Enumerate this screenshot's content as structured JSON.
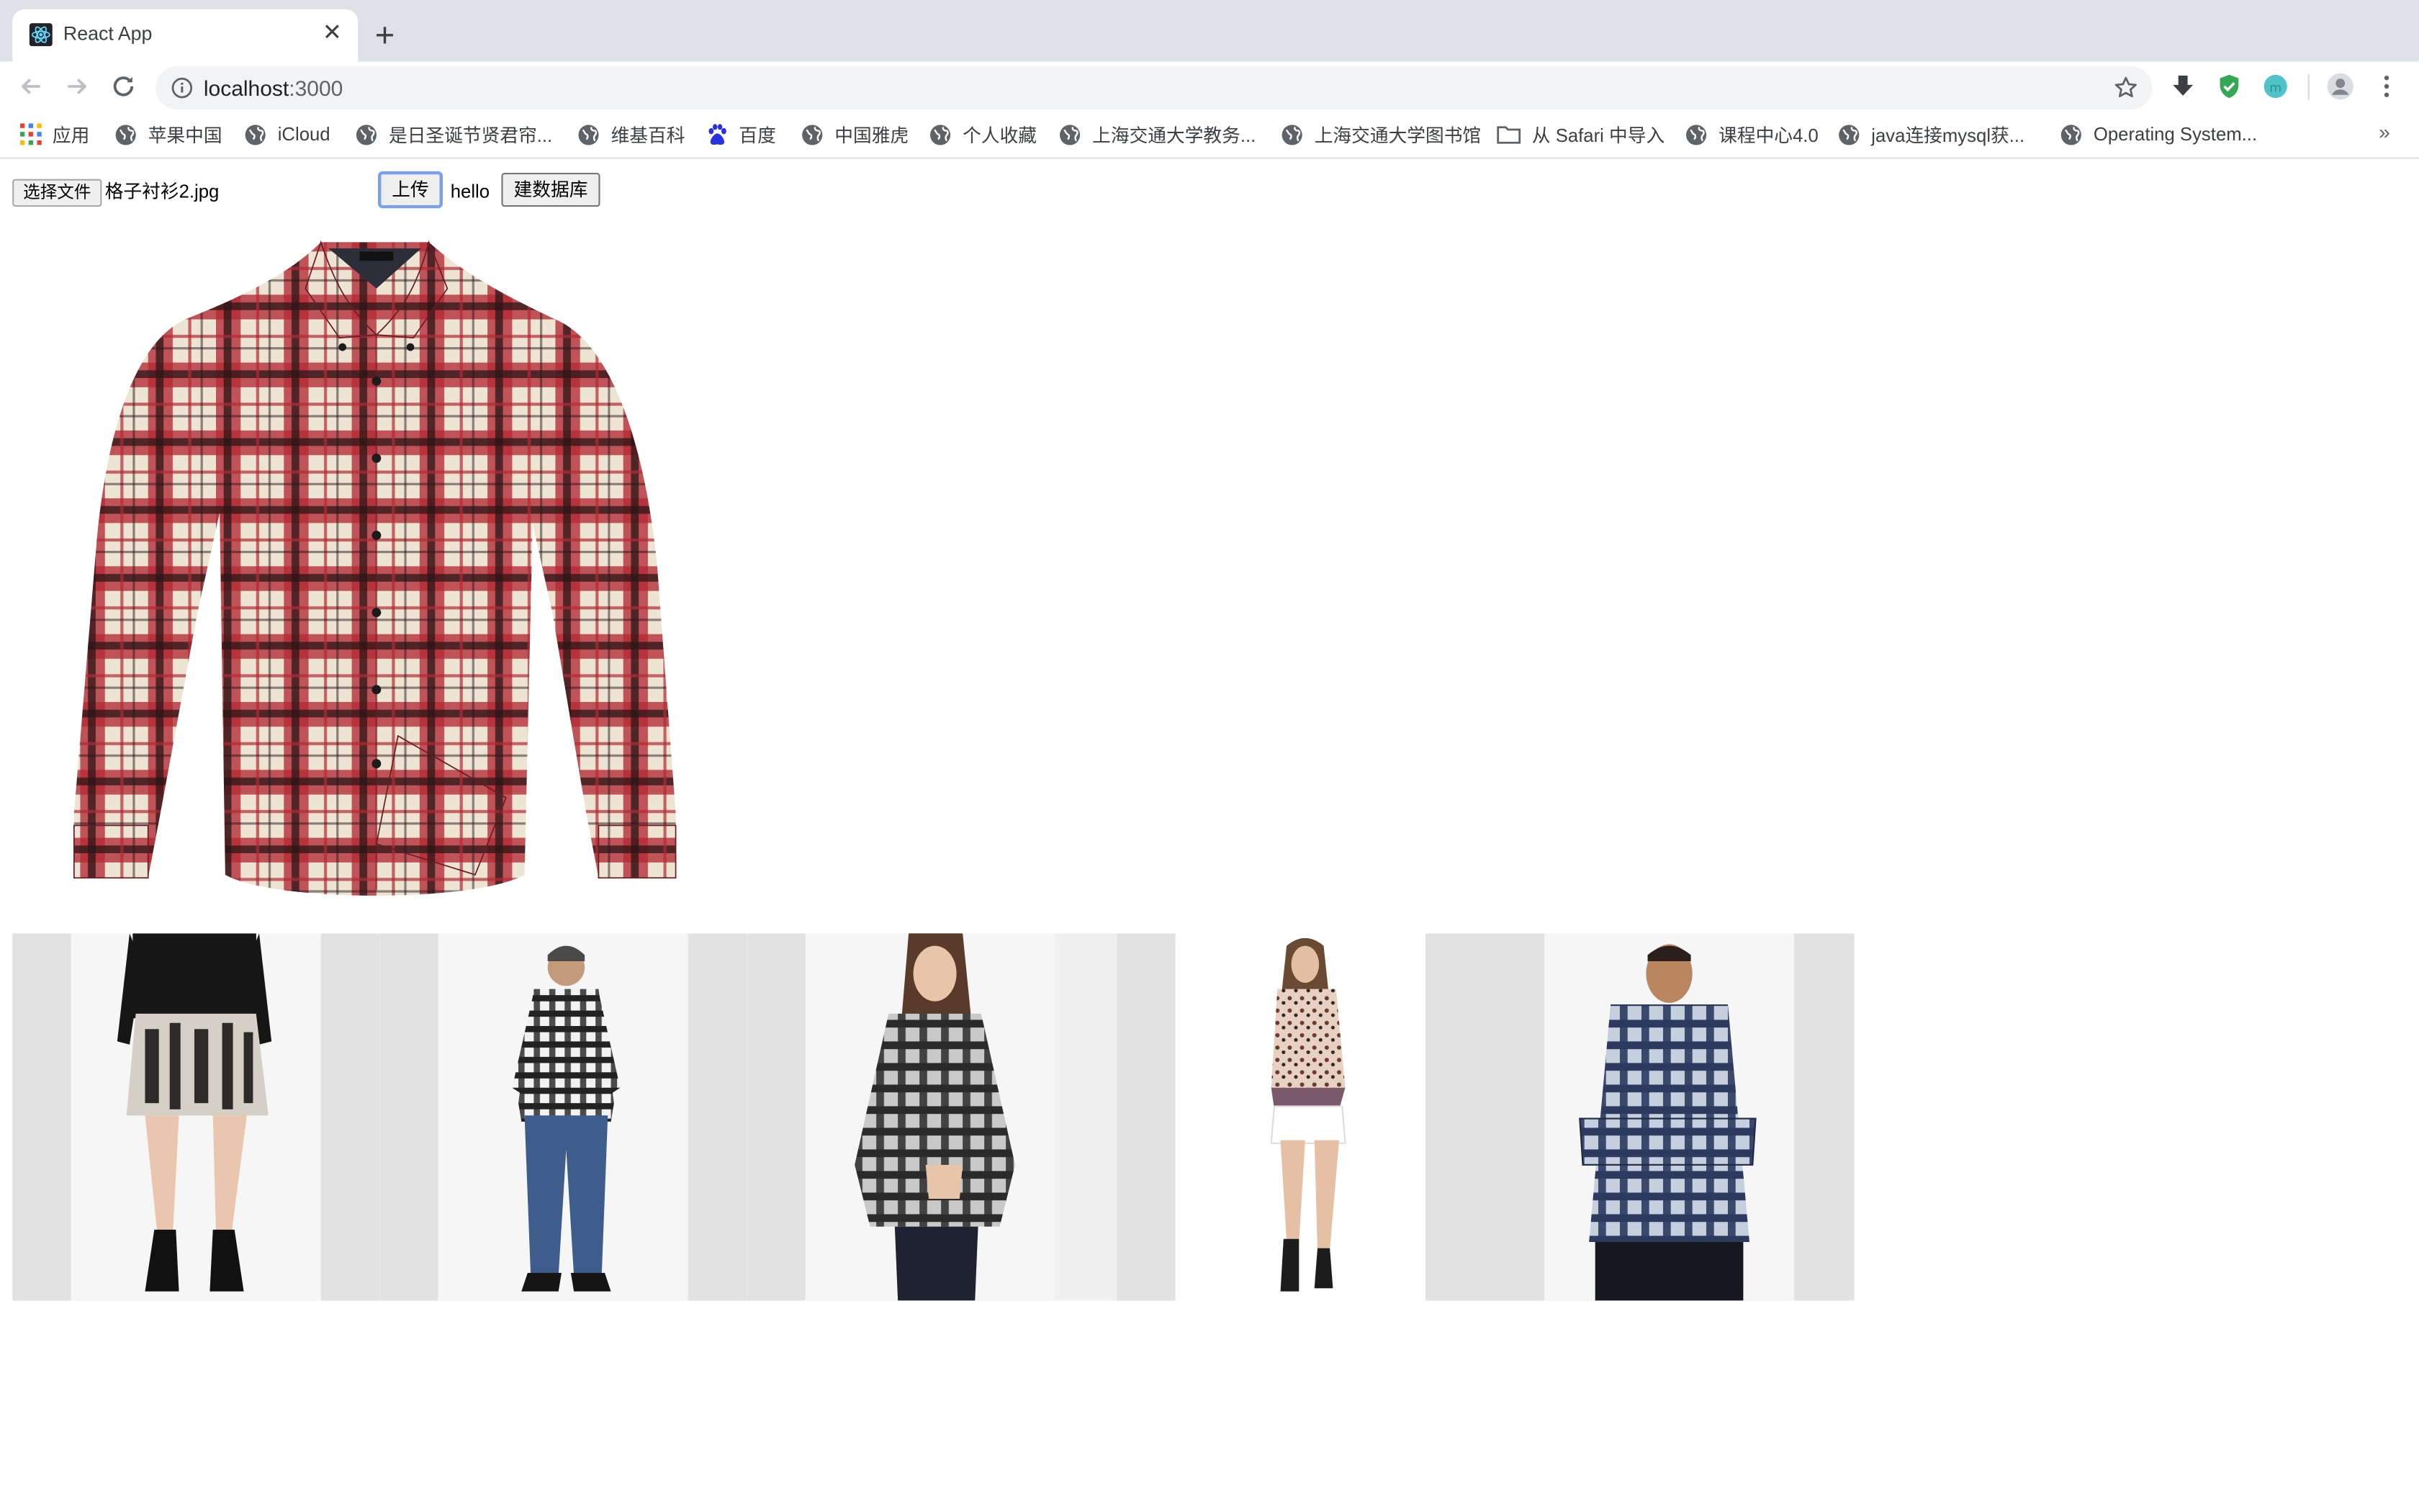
{
  "browser": {
    "tab_title": "React App",
    "url_host": "localhost",
    "url_port": ":3000",
    "accent": "#4285f4"
  },
  "bookmarks": [
    {
      "icon": "apps-grid-icon",
      "label": "应用"
    },
    {
      "icon": "globe-icon",
      "label": "苹果中国"
    },
    {
      "icon": "globe-icon",
      "label": "iCloud"
    },
    {
      "icon": "globe-icon",
      "label": "是日圣诞节贤君帘..."
    },
    {
      "icon": "globe-icon",
      "label": "维基百科"
    },
    {
      "icon": "baidu-paw-icon",
      "label": "百度"
    },
    {
      "icon": "globe-icon",
      "label": "中国雅虎"
    },
    {
      "icon": "globe-icon",
      "label": "个人收藏"
    },
    {
      "icon": "globe-icon",
      "label": "上海交通大学教务..."
    },
    {
      "icon": "globe-icon",
      "label": "上海交通大学图书馆"
    },
    {
      "icon": "folder-icon",
      "label": "从 Safari 中导入"
    },
    {
      "icon": "globe-icon",
      "label": "课程中心4.0"
    },
    {
      "icon": "globe-icon",
      "label": "java连接mysql获..."
    },
    {
      "icon": "globe-icon",
      "label": "Operating System..."
    }
  ],
  "bookmarks_overflow": "»",
  "page": {
    "file_button_label": "选择文件",
    "file_name": "格子衬衫2.jpg",
    "upload_button_label": "上传",
    "hello_text": "hello",
    "build_db_button_label": "建数据库"
  },
  "results": [
    {
      "subject": "woman in patterned skirt, black top and boots"
    },
    {
      "subject": "man in black and white plaid shirt and jeans"
    },
    {
      "subject": "woman in grey plaid flannel shirt"
    },
    {
      "subject": "woman in leopard print blouse and white shorts"
    },
    {
      "subject": "man in navy plaid shirt with arms crossed"
    }
  ]
}
